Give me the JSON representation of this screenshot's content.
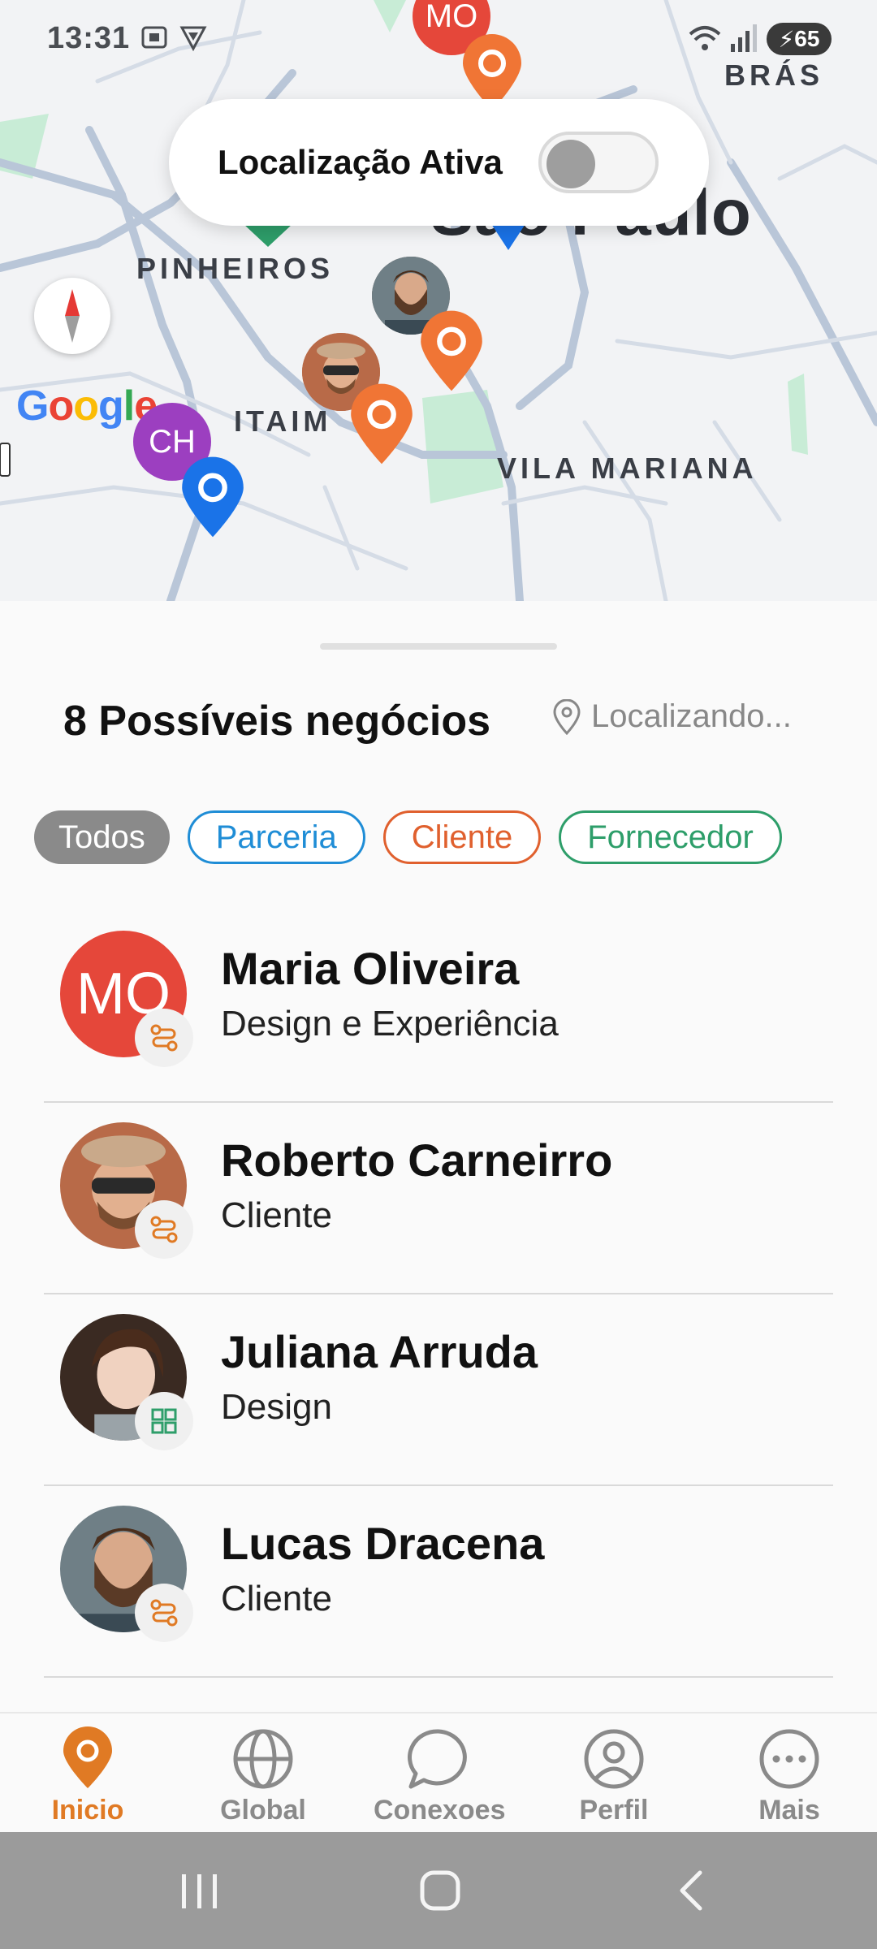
{
  "status": {
    "time": "13:31",
    "battery": "65"
  },
  "map": {
    "city": "São Paulo",
    "districts": [
      "BRÁS",
      "PINHEIROS",
      "ITAIM",
      "VILA MARIANA"
    ],
    "google": "Google",
    "avatar_initials": [
      "MO",
      "CH"
    ]
  },
  "location_toggle": {
    "label": "Localização Ativa",
    "enabled": false
  },
  "sheet": {
    "title": "8 Possíveis negócios",
    "locating": "Localizando..."
  },
  "filters": [
    {
      "label": "Todos",
      "active": true
    },
    {
      "label": "Parceria",
      "color": "#1f8dd6"
    },
    {
      "label": "Cliente",
      "color": "#e0602e"
    },
    {
      "label": "Fornecedor",
      "color": "#2e9e6a"
    }
  ],
  "contacts": [
    {
      "name": "Maria Oliveira",
      "subtitle": "Design e Experiência",
      "initials": "MO",
      "badge": "route-icon"
    },
    {
      "name": "Roberto Carneirro",
      "subtitle": "Cliente",
      "badge": "route-icon"
    },
    {
      "name": "Juliana Arruda",
      "subtitle": "Design",
      "badge": "grid-icon"
    },
    {
      "name": "Lucas Dracena",
      "subtitle": "Cliente",
      "badge": "route-icon"
    }
  ],
  "nav": [
    {
      "label": "Inicio",
      "active": true
    },
    {
      "label": "Global"
    },
    {
      "label": "Conexoes"
    },
    {
      "label": "Perfil"
    },
    {
      "label": "Mais"
    }
  ],
  "colors": {
    "accent": "#e07a24",
    "pin_orange": "#f07535",
    "pin_blue": "#1a73e8",
    "avatar_purple": "#9c3fc0",
    "avatar_red": "#e5473a"
  }
}
